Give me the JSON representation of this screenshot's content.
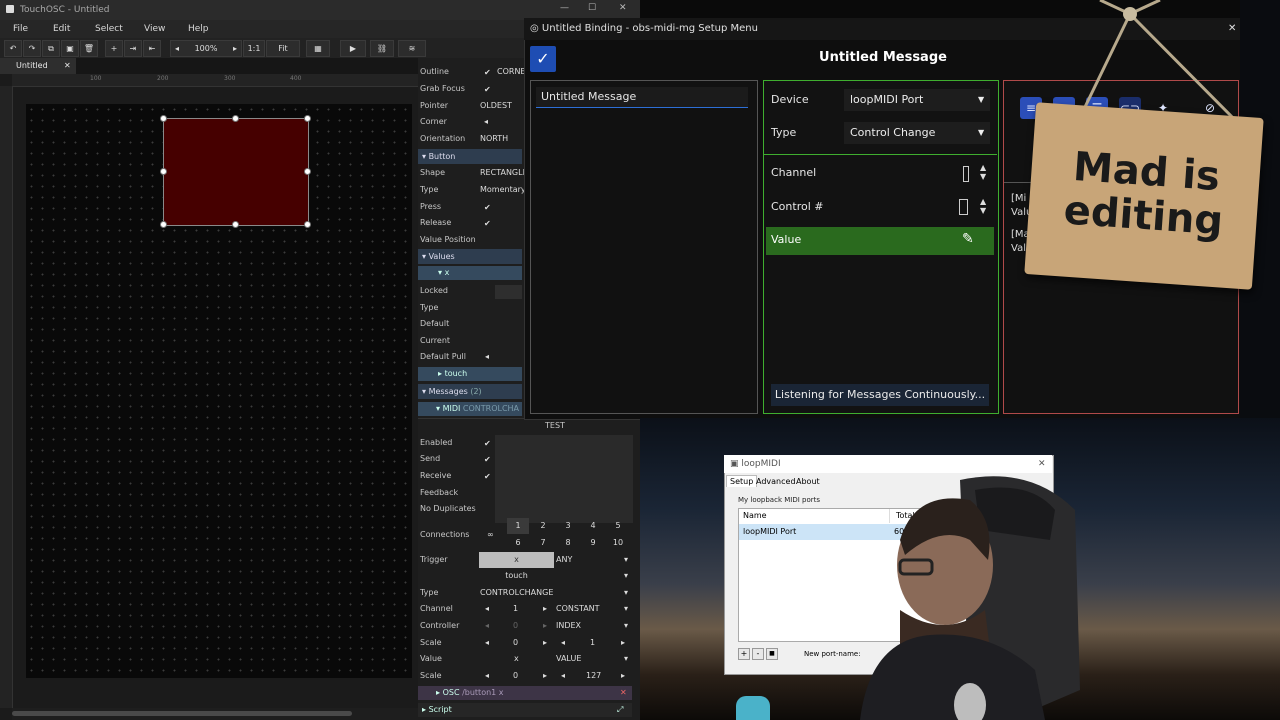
{
  "touchosc": {
    "window_title": "TouchOSC - Untitled",
    "win_controls": [
      "—",
      "☐",
      "✕"
    ],
    "menu": [
      "File",
      "Edit",
      "Select",
      "View",
      "Help"
    ],
    "toolbar": {
      "zoom": "100%",
      "ratio": "1:1",
      "fit": "Fit"
    },
    "doc_tab": "Untitled",
    "ruler_ticks": [
      "100",
      "200",
      "300",
      "400"
    ],
    "inspector": {
      "rows": [
        {
          "label": "Outline",
          "value": "✔",
          "extra": "CORNE"
        },
        {
          "label": "Grab Focus",
          "value": "✔"
        },
        {
          "label": "Pointer",
          "value": "OLDEST"
        },
        {
          "label": "Corner",
          "value": "◂"
        },
        {
          "label": "Orientation",
          "value": "NORTH"
        }
      ],
      "button_section": "Button",
      "button_rows": [
        {
          "label": "Shape",
          "value": "RECTANGLE"
        },
        {
          "label": "Type",
          "value": "Momentary"
        },
        {
          "label": "Press",
          "value": "✔"
        },
        {
          "label": "Release",
          "value": "✔"
        },
        {
          "label": "Value Position",
          "value": ""
        }
      ],
      "values_section": "Values",
      "values_x": "x",
      "value_rows": [
        {
          "label": "Locked",
          "value": ""
        },
        {
          "label": "Type",
          "value": ""
        },
        {
          "label": "Default",
          "value": ""
        },
        {
          "label": "Current",
          "value": ""
        },
        {
          "label": "Default Pull",
          "value": "◂"
        }
      ],
      "touch": "touch",
      "messages_section": "Messages",
      "messages_count": "(2)",
      "midi_label": "MIDI",
      "midi_type": "CONTROLCHA",
      "test_label": "TEST",
      "flags": [
        {
          "label": "Enabled",
          "value": "✔"
        },
        {
          "label": "Send",
          "value": "✔"
        },
        {
          "label": "Receive",
          "value": "✔"
        },
        {
          "label": "Feedback",
          "value": ""
        },
        {
          "label": "No Duplicates",
          "value": ""
        }
      ],
      "connections_label": "Connections",
      "connections_inf": "∞",
      "connections": [
        "1",
        "2",
        "3",
        "4",
        "5",
        "6",
        "7",
        "8",
        "9",
        "10"
      ],
      "trigger_label": "Trigger",
      "trigger_x": "x",
      "trigger_any": "ANY",
      "trigger_touch": "touch",
      "midi_rows": [
        {
          "label": "Type",
          "a": "CONTROLCHANGE",
          "b": ""
        },
        {
          "label": "Channel",
          "a": "1",
          "b": "CONSTANT"
        },
        {
          "label": "Controller",
          "a": "0",
          "b": "INDEX"
        },
        {
          "label": "Scale",
          "a": "0",
          "b": "1"
        },
        {
          "label": "Value",
          "a": "x",
          "b": "VALUE"
        },
        {
          "label": "Scale",
          "a": "0",
          "b": "127"
        }
      ],
      "osc_label": "OSC",
      "osc_path": "/button1 x",
      "script_label": "Script"
    }
  },
  "binding": {
    "window_title": "Untitled Binding - obs-midi-mg Setup Menu",
    "heading": "Untitled Message",
    "list_item": "Untitled Message",
    "device_label": "Device",
    "device_value": "loopMIDI Port",
    "type_label": "Type",
    "type_value": "Control Change",
    "channel_label": "Channel",
    "control_label": "Control #",
    "value_label": "Value",
    "listen_button": "Listening for Messages Continuously...",
    "right_text_1": "[Mi",
    "right_text_2": "Valu",
    "right_text_3": "[Ma",
    "right_text_4": "Valu"
  },
  "sign": {
    "text_line1": "Mad is",
    "text_line2": "editing"
  },
  "loopmidi": {
    "title": "loopMIDI",
    "tabs": [
      "Setup",
      "Advanced",
      "About"
    ],
    "group_label": "My loopback MIDI ports",
    "col_name": "Name",
    "col_total": "Total da",
    "port_name": "loopMIDI Port",
    "port_total": "606",
    "new_port_label": "New port-name:",
    "buttons": [
      "+",
      "-",
      "■"
    ]
  },
  "colors": {
    "button_fill": "#460000",
    "green_border": "#3fae2f",
    "accent_blue": "#1e4db3"
  }
}
